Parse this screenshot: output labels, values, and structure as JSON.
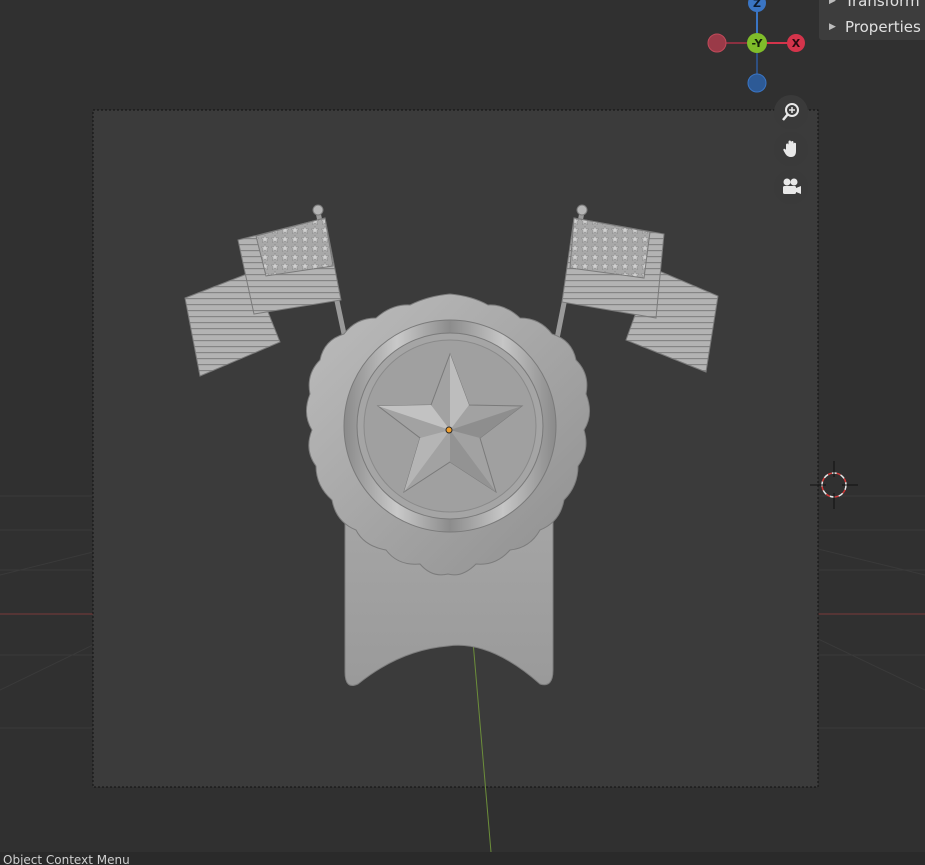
{
  "sidebar": {
    "tabs": [
      {
        "label": "Transform",
        "expanded": false
      },
      {
        "label": "Properties",
        "expanded": false
      }
    ]
  },
  "gizmo": {
    "axes": {
      "z": "Z",
      "neg_y": "-Y",
      "x": "X"
    },
    "colors": {
      "x": "#d4344b",
      "y": "#7fbd2a",
      "z": "#3a75c4"
    }
  },
  "navigation": {
    "buttons": [
      {
        "name": "zoom-view-button",
        "icon": "zoom-icon"
      },
      {
        "name": "pan-view-button",
        "icon": "hand-icon"
      },
      {
        "name": "camera-view-button",
        "icon": "camera-icon"
      }
    ]
  },
  "viewport": {
    "background": "#303030",
    "camera_frame_fill": "#3b3b3b",
    "object": "medal with star and two flags"
  },
  "status_bar": {
    "text": "Object Context Menu"
  }
}
